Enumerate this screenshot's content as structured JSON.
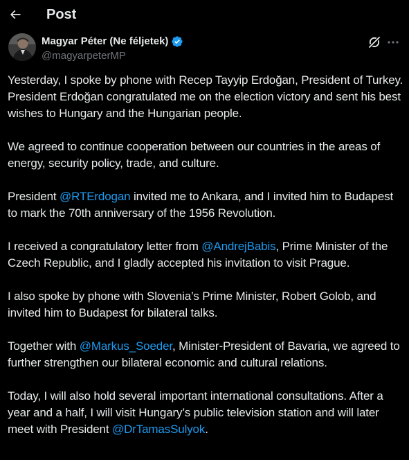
{
  "header": {
    "title": "Post"
  },
  "author": {
    "display_name": "Magyar Péter (Ne féljetek)",
    "handle": "@magyarpeterMP"
  },
  "colors": {
    "background": "#000000",
    "text": "#e7e9ea",
    "secondary_text": "#71767b",
    "link": "#1d9bf0",
    "verified_badge": "#1d9bf0"
  },
  "icons": {
    "back": "arrow-left-icon",
    "verified": "verified-badge-icon",
    "grok": "grok-icon",
    "more": "more-horizontal-icon"
  },
  "tweet": {
    "p1": "Yesterday, I spoke by phone with Recep Tayyip Erdoğan, President of Turkey. President Erdoğan congratulated me on the election victory and sent his best wishes to Hungary and the Hungarian people.",
    "p2": "We agreed to continue cooperation between our countries in the areas of energy, security policy, trade, and culture.",
    "p3_before": "President ",
    "p3_mention": "@RTErdogan",
    "p3_after": " invited me to Ankara, and I invited him to Budapest to mark the 70th anniversary of the 1956 Revolution.",
    "p4_before": "I received a congratulatory letter from ",
    "p4_mention": "@AndrejBabis",
    "p4_after": ", Prime Minister of the Czech Republic, and I gladly accepted his invitation to visit Prague.",
    "p5": "I also spoke by phone with Slovenia’s Prime Minister, Robert Golob, and invited him to Budapest for bilateral talks.",
    "p6_before": "Together with ",
    "p6_mention": "@Markus_Soeder",
    "p6_after": ", Minister-President of Bavaria, we agreed to further strengthen our bilateral economic and cultural relations.",
    "p7_before": "Today, I will also hold several important international consultations. After a year and a half, I will visit Hungary’s public television station and will later meet with President ",
    "p7_mention": "@DrTamasSulyok",
    "p7_after": "."
  }
}
